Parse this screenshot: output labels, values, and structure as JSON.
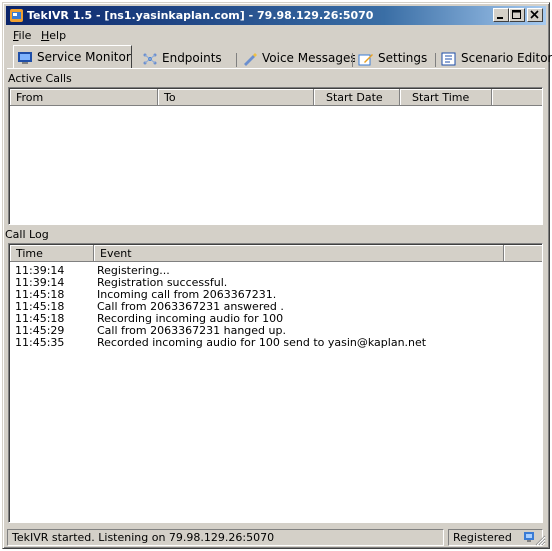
{
  "window": {
    "title": "TekIVR 1.5 - [ns1.yasinkaplan.com] - 79.98.129.26:5070"
  },
  "menu": [
    {
      "label": "File",
      "accel": "F",
      "rest": "ile"
    },
    {
      "label": "Help",
      "accel": "H",
      "rest": "elp"
    }
  ],
  "tabs": [
    {
      "label": "Service Monitor",
      "icon": "monitor-icon",
      "active": true
    },
    {
      "label": "Endpoints",
      "icon": "endpoints-icon",
      "active": false
    },
    {
      "label": "Voice Messages",
      "icon": "pen-icon",
      "active": false
    },
    {
      "label": "Settings",
      "icon": "settings-icon",
      "active": false
    },
    {
      "label": "Scenario Editor",
      "icon": "scenario-icon",
      "active": false
    }
  ],
  "active_calls": {
    "label": "Active Calls",
    "columns": [
      "From",
      "To",
      "Start Date",
      "Start Time"
    ]
  },
  "call_log": {
    "label": "Call Log",
    "columns": [
      "Time",
      "Event"
    ],
    "rows": [
      {
        "time": "11:39:14",
        "event": "Registering..."
      },
      {
        "time": "11:39:14",
        "event": "Registration successful."
      },
      {
        "time": "11:45:18",
        "event": "Incoming call from 2063367231."
      },
      {
        "time": "11:45:18",
        "event": "Call from 2063367231 answered ."
      },
      {
        "time": "11:45:18",
        "event": "Recording incoming audio for 100"
      },
      {
        "time": "11:45:29",
        "event": "Call from 2063367231 hanged up."
      },
      {
        "time": "11:45:35",
        "event": "Recorded incoming audio for 100 send to yasin@kaplan.net"
      }
    ]
  },
  "status": {
    "message": "TekIVR started. Listening on 79.98.129.26:5070",
    "state": "Registered"
  },
  "colors": {
    "face": "#d4d0c8",
    "title_start": "#0a246a",
    "title_end": "#a6caf0"
  }
}
